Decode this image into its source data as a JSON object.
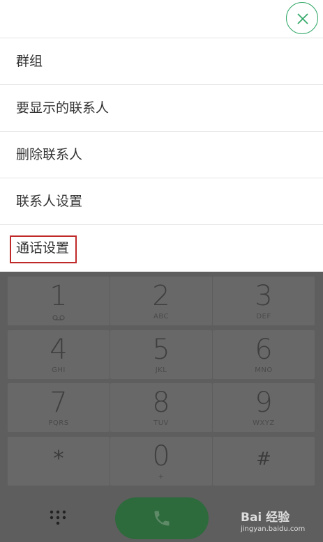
{
  "menu": {
    "items": [
      {
        "label": "群组"
      },
      {
        "label": "要显示的联系人"
      },
      {
        "label": "删除联系人"
      },
      {
        "label": "联系人设置"
      },
      {
        "label": "通话设置"
      }
    ],
    "close_icon": "close-icon"
  },
  "dialer": {
    "keys": [
      {
        "digit": "1",
        "letters": ""
      },
      {
        "digit": "2",
        "letters": "ABC"
      },
      {
        "digit": "3",
        "letters": "DEF"
      },
      {
        "digit": "4",
        "letters": "GHI"
      },
      {
        "digit": "5",
        "letters": "JKL"
      },
      {
        "digit": "6",
        "letters": "MNO"
      },
      {
        "digit": "7",
        "letters": "PQRS"
      },
      {
        "digit": "8",
        "letters": "TUV"
      },
      {
        "digit": "9",
        "letters": "WXYZ"
      },
      {
        "digit": "*",
        "letters": ""
      },
      {
        "digit": "0",
        "letters": "+"
      },
      {
        "digit": "#",
        "letters": ""
      }
    ]
  },
  "watermark": {
    "brand": "Bai 经验",
    "url": "jingyan.baidu.com"
  },
  "colors": {
    "accent": "#35a96a",
    "highlight": "#c0292a",
    "call": "#2d6a3c"
  }
}
